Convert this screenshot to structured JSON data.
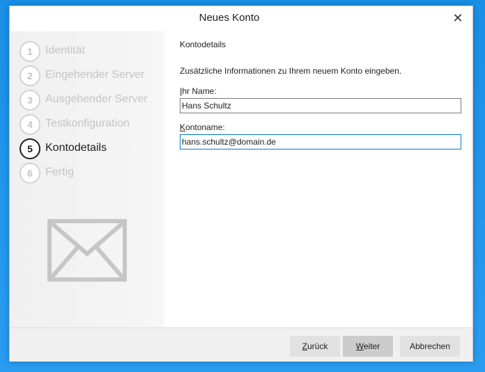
{
  "window": {
    "title": "Neues Konto",
    "close_icon": "close-icon"
  },
  "steps": [
    {
      "number": "1",
      "label": "Identität",
      "active": false
    },
    {
      "number": "2",
      "label": "Eingehender Server",
      "active": false
    },
    {
      "number": "3",
      "label": "Ausgehender Server",
      "active": false
    },
    {
      "number": "4",
      "label": "Testkonfiguration",
      "active": false
    },
    {
      "number": "5",
      "label": "Kontodetails",
      "active": true
    },
    {
      "number": "6",
      "label": "Fertig",
      "active": false
    }
  ],
  "sidebar_graphic": "envelope-icon",
  "content": {
    "section_title": "Kontodetails",
    "intro": "Zusätzliche Informationen zu Ihrem neuem Konto eingeben.",
    "name_field": {
      "label_access": "I",
      "label_rest": "hr Name:",
      "value": "Hans Schultz"
    },
    "account_field": {
      "label_access": "K",
      "label_rest": "ontoname:",
      "value": "hans.schultz@domain.de"
    }
  },
  "buttons": {
    "back": {
      "access": "Z",
      "rest": "urück"
    },
    "next": {
      "access": "W",
      "rest": "eiter"
    },
    "cancel": "Abbrechen"
  },
  "colors": {
    "desktop": "#1a8fe6",
    "focus_border": "#0078d7",
    "inactive_step": "#c4c4c4",
    "active_step": "#1e1e1e"
  }
}
